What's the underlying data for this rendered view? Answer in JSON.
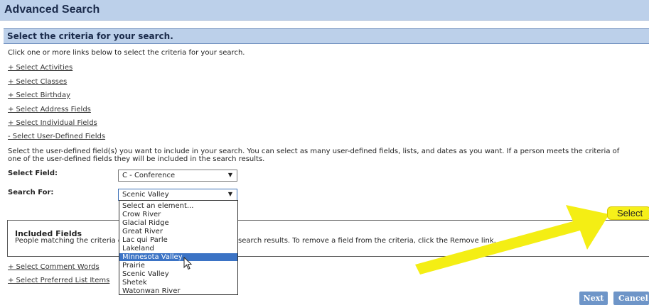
{
  "page": {
    "title": "Advanced Search",
    "section_title": "Select the criteria for your search.",
    "intro": "Click one or more links below to select the criteria for your search."
  },
  "criteria_links": [
    "+ Select Activities",
    "+ Select Classes",
    "+ Select Birthday",
    "+ Select Address Fields",
    "+ Select Individual Fields",
    "- Select User-Defined Fields"
  ],
  "udf": {
    "instructions": "Select the user-defined field(s) you want to include in your search. You can select as many user-defined fields, lists, and dates as you want. If a person meets the criteria of one of the user-defined fields they will be included in the search results.",
    "select_field_label": "Select Field:",
    "select_field_value": "C - Conference",
    "search_for_label": "Search For:",
    "search_for_value": "Scenic Valley",
    "options": [
      "Select an element...",
      "Crow River",
      "Glacial Ridge",
      "Great River",
      "Lac qui Parle",
      "Lakeland",
      "Minnesota Valley",
      "Prairie",
      "Scenic Valley",
      "Shetek",
      "Watonwan River"
    ],
    "highlighted_option": "Minnesota Valley",
    "select_button_label": "Select"
  },
  "included": {
    "title": "Included Fields",
    "text_left": "People matching the criteria of",
    "text_right": "search results. To remove a field from the criteria, click the Remove link."
  },
  "more_links": [
    "+ Select Comment Words",
    "+ Select Preferred List Items"
  ],
  "footer": {
    "next_label": "Next",
    "cancel_label": "Cancel"
  },
  "colors": {
    "header_bg": "#bcd0ea",
    "button_bg": "#6e95c8",
    "callout": "#f6f01a",
    "highlight": "#3b73c5"
  },
  "icons": {
    "dropdown_arrow": "triangle-down",
    "cursor": "mouse-pointer",
    "annotation": "yellow-arrow"
  }
}
